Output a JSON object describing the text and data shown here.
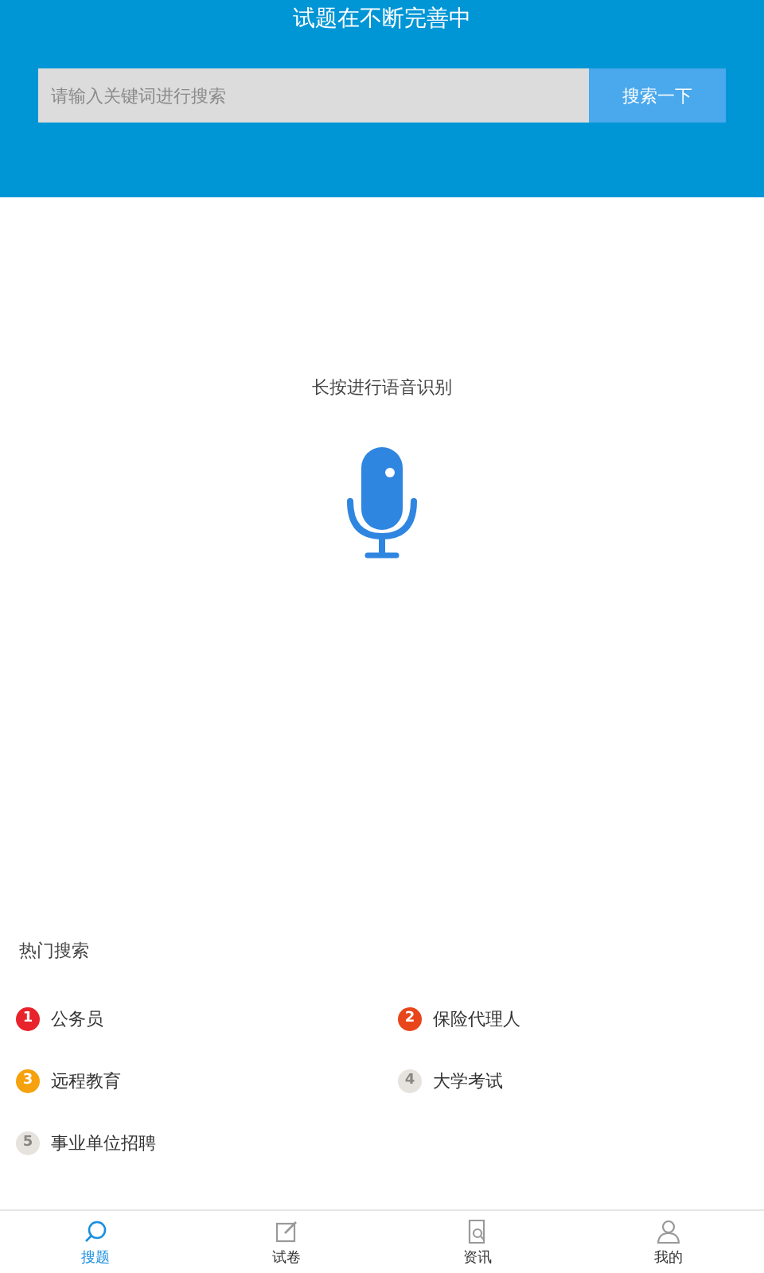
{
  "header": {
    "title": "试题在不断完善中"
  },
  "search": {
    "placeholder": "请输入关键词进行搜索",
    "button": "搜索一下"
  },
  "voice": {
    "hint": "长按进行语音识别"
  },
  "hot_search": {
    "title": "热门搜索",
    "items": [
      {
        "rank": "1",
        "label": "公务员",
        "color": "#e8232b"
      },
      {
        "rank": "2",
        "label": "保险代理人",
        "color": "#e8461a"
      },
      {
        "rank": "3",
        "label": "远程教育",
        "color": "#f5a20e"
      },
      {
        "rank": "4",
        "label": "大学考试",
        "color": "#e6e2de"
      },
      {
        "rank": "5",
        "label": "事业单位招聘",
        "color": "#e6e2de"
      }
    ]
  },
  "tabs": [
    {
      "label": "搜题",
      "kind": "search",
      "selected": true
    },
    {
      "label": "试卷",
      "kind": "edit",
      "selected": false
    },
    {
      "label": "资讯",
      "kind": "document",
      "selected": false
    },
    {
      "label": "我的",
      "kind": "person",
      "selected": false
    }
  ]
}
